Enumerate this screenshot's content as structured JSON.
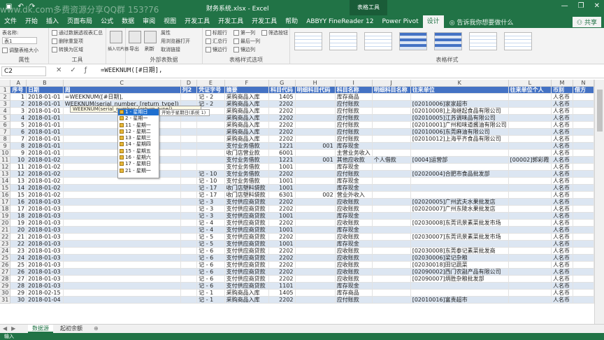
{
  "window": {
    "title": "财务系统.xlsx - Excel",
    "context_tab": "表格工具"
  },
  "watermark": "www.dk.com多费资源分享QQ群  153?76",
  "tabs": [
    "文件",
    "开始",
    "插入",
    "页面布局",
    "公式",
    "数据",
    "审阅",
    "视图",
    "开发工具",
    "开发工具",
    "开发工具",
    "帮助",
    "ABBYY FineReader 12",
    "Power Pivot",
    "设计"
  ],
  "tell_me": "告诉我你想要做什么",
  "share": "共享",
  "ribbon": {
    "props_label": "表名称:",
    "table_name": "表1",
    "resize": "调整表格大小",
    "group_props": "属性",
    "summarize": "通过数据透视表汇总",
    "remove_dup": "删除重复项",
    "convert": "转换为区域",
    "group_tools": "工具",
    "slicer": "插入切片器",
    "export": "导出",
    "refresh": "刷新",
    "ext_props": "属性",
    "open_browser": "用浏览器打开",
    "unlink": "取消链接",
    "group_ext": "外部表数据",
    "header_row": "标题行",
    "first_col": "第一列",
    "filter_btn": "筛选按钮",
    "total_row": "汇总行",
    "last_col": "最后一列",
    "banded_rows": "镶边行",
    "banded_cols": "镶边列",
    "group_style_opts": "表格样式选项",
    "group_styles": "表格样式"
  },
  "formula_bar": {
    "name_box": "C2",
    "formula": "=WEEKNUM([#日期],"
  },
  "columns": [
    "A",
    "B",
    "C",
    "D",
    "E",
    "F",
    "G",
    "H",
    "I",
    "J",
    "K",
    "L",
    "M",
    "N"
  ],
  "headers": [
    "序号",
    "日期",
    "周",
    "列2",
    "凭证字号",
    "摘要",
    "科目代码",
    "明细科目代码",
    "科目名称",
    "明细科目名称",
    "往来单位",
    "往来单位个人",
    "币别",
    "借方"
  ],
  "rows": [
    [
      "1",
      "2018-01-01",
      "=WEEKNUM([#日期],",
      "",
      "记 - 2",
      "采购商品入库",
      "1405",
      "",
      "库存商品",
      "",
      "",
      "",
      "人名币",
      ""
    ],
    [
      "2",
      "2018-01-01",
      "WEEKNUM(serial_number, [return_type])",
      "",
      "记 - 2",
      "采购商品入库",
      "2202",
      "",
      "应付账款",
      "",
      "[02010006]家家超市",
      "",
      "人名币",
      ""
    ],
    [
      "3",
      "2018-01-01",
      "",
      "",
      "",
      "采购商品入库",
      "2202",
      "",
      "应付账款",
      "",
      "[02010008]上海继起食品有限公司",
      "",
      "人名币",
      ""
    ],
    [
      "4",
      "2018-01-01",
      "",
      "",
      "",
      "采购商品入库",
      "2202",
      "",
      "应付账款",
      "",
      "[02010005]江苏调味品有限公司",
      "",
      "人名币",
      ""
    ],
    [
      "5",
      "2018-01-01",
      "",
      "",
      "",
      "采购商品入库",
      "2202",
      "",
      "应付账款",
      "",
      "[02010001]广州和味道酱油有限公司",
      "",
      "人名币",
      ""
    ],
    [
      "6",
      "2018-01-01",
      "",
      "",
      "",
      "采购商品入库",
      "2202",
      "",
      "应付账款",
      "",
      "[02010006]东莞麻油有限公司",
      "",
      "人名币",
      ""
    ],
    [
      "7",
      "2018-01-01",
      "",
      "",
      "",
      "采购商品入库",
      "2202",
      "",
      "应付账款",
      "",
      "[02010012]上海平齐食品有限公司",
      "",
      "人名币",
      ""
    ],
    [
      "8",
      "2018-01-01",
      "",
      "",
      "",
      "支付业务借款",
      "1221",
      "001",
      "库存现金",
      "",
      "",
      "",
      "人名币",
      ""
    ],
    [
      "9",
      "2018-01-01",
      "",
      "",
      "",
      "收门店营业款",
      "6001",
      "",
      "主营业务收入",
      "",
      "",
      "",
      "人名币",
      ""
    ],
    [
      "10",
      "2018-01-02",
      "",
      "",
      "",
      "支付业务借款",
      "1221",
      "001",
      "其他应收款",
      "个人借款",
      "[0004]运营部",
      "[00002]郭彩霞",
      "人名币",
      ""
    ],
    [
      "11",
      "2018-01-02",
      "",
      "",
      "",
      "支付业务借款",
      "1001",
      "",
      "库存现金",
      "",
      "",
      "",
      "人名币",
      ""
    ],
    [
      "12",
      "2018-01-02",
      "",
      "",
      "记 - 10",
      "支付业务借款",
      "2202",
      "",
      "应付账款",
      "",
      "[02020004]合肥市食品批发部",
      "",
      "人名币",
      ""
    ],
    [
      "13",
      "2018-01-02",
      "",
      "",
      "记 - 10",
      "支付业务借款",
      "1001",
      "",
      "库存现金",
      "",
      "",
      "",
      "人名币",
      ""
    ],
    [
      "14",
      "2018-01-02",
      "",
      "",
      "记 - 17",
      "收门店塑料袋款",
      "1001",
      "",
      "库存现金",
      "",
      "",
      "",
      "人名币",
      ""
    ],
    [
      "15",
      "2018-01-02",
      "",
      "",
      "记 - 17",
      "收门店塑料袋款",
      "6301",
      "002",
      "营业外收入",
      "",
      "",
      "",
      "人名币",
      ""
    ],
    [
      "16",
      "2018-01-03",
      "",
      "",
      "记 - 3",
      "支付供应商贷款",
      "2202",
      "",
      "应收账款",
      "",
      "[02020005]广州武夫水果批发店",
      "",
      "人名币",
      ""
    ],
    [
      "17",
      "2018-01-03",
      "",
      "",
      "记 - 3",
      "支付供应商贷款",
      "2202",
      "",
      "应收账款",
      "",
      "[02020007]广州东陵水果批发店",
      "",
      "人名币",
      ""
    ],
    [
      "18",
      "2018-01-03",
      "",
      "",
      "记 - 3",
      "支付供应商贷款",
      "1001",
      "",
      "库存现金",
      "",
      "",
      "",
      "人名币",
      ""
    ],
    [
      "19",
      "2018-01-03",
      "",
      "",
      "记 - 4",
      "支付供应商贷款",
      "2202",
      "",
      "应收账款",
      "",
      "[02030008]东莞讯景素菜批发市场",
      "",
      "人名币",
      ""
    ],
    [
      "20",
      "2018-01-03",
      "",
      "",
      "记 - 4",
      "支付供应商贷款",
      "1001",
      "",
      "库存现金",
      "",
      "",
      "",
      "人名币",
      ""
    ],
    [
      "21",
      "2018-01-03",
      "",
      "",
      "记 - 5",
      "支付供应商贷款",
      "2202",
      "",
      "应收账款",
      "",
      "[02030007]东莞讯景素菜批发市场",
      "",
      "人名币",
      ""
    ],
    [
      "22",
      "2018-01-03",
      "",
      "",
      "记 - 5",
      "支付供应商贷款",
      "1001",
      "",
      "库存现金",
      "",
      "",
      "",
      "人名币",
      ""
    ],
    [
      "23",
      "2018-01-03",
      "",
      "",
      "记 - 6",
      "支付供应商贷款",
      "2202",
      "",
      "应收账款",
      "",
      "[02030008]东莞泰记素菜批发商",
      "",
      "人名币",
      ""
    ],
    [
      "24",
      "2018-01-03",
      "",
      "",
      "记 - 6",
      "支付供应商贷款",
      "2202",
      "",
      "应收账款",
      "",
      "[02030006]梁记杂粮",
      "",
      "人名币",
      ""
    ],
    [
      "25",
      "2018-01-03",
      "",
      "",
      "记 - 6",
      "支付供应商贷款",
      "2202",
      "",
      "应收账款",
      "",
      "[02030018]田记蔬菜",
      "",
      "人名币",
      ""
    ],
    [
      "26",
      "2018-01-03",
      "",
      "",
      "记 - 6",
      "支付供应商贷款",
      "2202",
      "",
      "应收账款",
      "",
      "[02090002]西门农副产品有限公司",
      "",
      "人名币",
      ""
    ],
    [
      "27",
      "2018-01-03",
      "",
      "",
      "记 - 6",
      "支付供应商贷款",
      "2202",
      "",
      "应收账款",
      "",
      "[02090007]炳胜杂粮批发部",
      "",
      "人名币",
      ""
    ],
    [
      "28",
      "2018-01-03",
      "",
      "",
      "记 - 6",
      "支付供应商贷款",
      "1101",
      "",
      "库存现金",
      "",
      "",
      "",
      "人名币",
      ""
    ],
    [
      "29",
      "2018-02-15",
      "",
      "",
      "记 - 1",
      "采购商品入库",
      "1405",
      "",
      "库存商品",
      "",
      "",
      "",
      "人名币",
      ""
    ],
    [
      "30",
      "2018-01-04",
      "",
      "",
      "记 - 1",
      "采购商品入库",
      "2202",
      "",
      "应付账款",
      "",
      "[02010016]富贵超市",
      "",
      "人名币",
      ""
    ]
  ],
  "row_numbers": [
    "1",
    "2",
    "3",
    "4",
    "5",
    "6",
    "7",
    "8",
    "9",
    "10",
    "11",
    "12",
    "13",
    "14",
    "15",
    "16",
    "17",
    "18",
    "19",
    "20",
    "21",
    "22",
    "23",
    "24",
    "25",
    "26",
    "27",
    "28",
    "29",
    "30",
    "31"
  ],
  "tooltip": "WEEKNUM(serial_number, [return_type])",
  "dropdown": [
    "1 - 星期日",
    "2 - 星期一",
    "11 - 星期一",
    "12 - 星期二",
    "13 - 星期三",
    "14 - 星期四",
    "15 - 星期五",
    "16 - 星期六",
    "17 - 星期日",
    "21 - 星期一"
  ],
  "dropdown_tip": "开始于星期日(系统 1)",
  "sheets": [
    "数据源",
    "起初余额"
  ],
  "status": "输入",
  "colors": {
    "accent": "#217346",
    "header": "#4472c4",
    "band": "#dce6f2"
  }
}
